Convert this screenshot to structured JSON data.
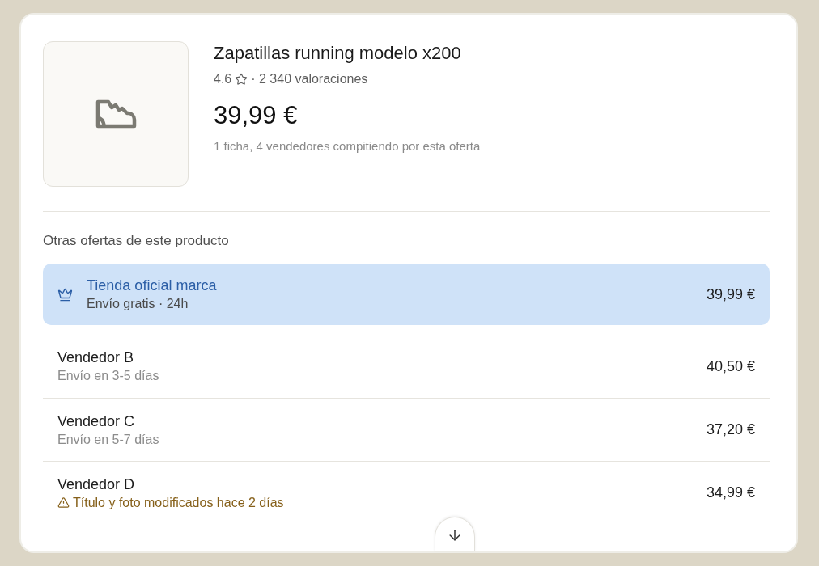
{
  "product": {
    "title": "Zapatillas running modelo x200",
    "rating": "4.6",
    "reviews": "· 2 340 valoraciones",
    "price": "39,99 €",
    "summary": "1 ficha, 4 vendedores compitiendo por esta oferta"
  },
  "offers_section": {
    "heading": "Otras ofertas de este producto",
    "offers": [
      {
        "kind": "official",
        "seller": "Tienda oficial marca",
        "detail": "Envío gratis · 24h",
        "price": "39,99 €",
        "selected": true
      },
      {
        "kind": "standard",
        "seller": "Vendedor B",
        "detail": "Envío en 3-5 días",
        "price": "40,50 €",
        "selected": false
      },
      {
        "kind": "standard",
        "seller": "Vendedor C",
        "detail": "Envío en 5-7 días",
        "price": "37,20 €",
        "selected": false
      },
      {
        "kind": "warning",
        "seller": "Vendedor D",
        "detail": "Título y foto modificados hace 2 días",
        "price": "34,99 €",
        "selected": false
      }
    ]
  }
}
